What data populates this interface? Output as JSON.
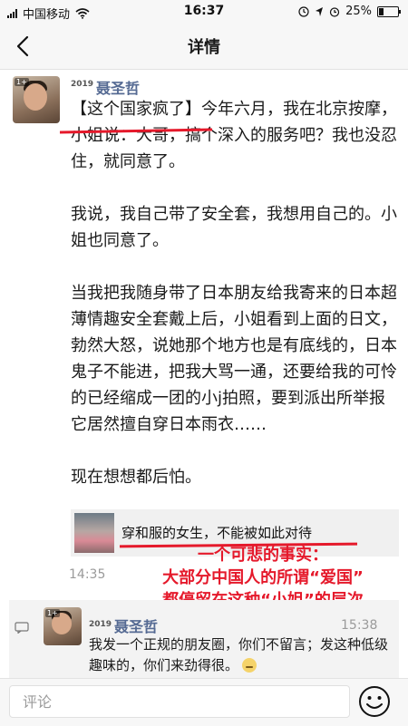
{
  "status_bar": {
    "carrier": "中国移动",
    "time": "16:37",
    "battery": "25%",
    "battery_level": 0.25
  },
  "nav": {
    "title": "详情"
  },
  "post": {
    "year_badge": "2019",
    "author": "聂圣哲",
    "avatar_tag": "1+",
    "paragraphs": [
      "【这个国家疯了】今年六月，我在北京按摩，小姐说：大哥，搞个深入的服务吧？我也没忍住，就同意了。",
      "我说，我自己带了安全套，我想用自己的。小姐也同意了。",
      "当我把我随身带了日本朋友给我寄来的日本超薄情趣安全套戴上后，小姐看到上面的日文，勃然大怒，说她那个地方也是有底线的，日本鬼子不能进，把我大骂一通，还要给我的可怜的已经缩成一团的小j拍照，要到派出所举报它居然擅自穿日本雨衣……",
      "现在想想都后怕。"
    ],
    "link_card": {
      "title": "穿和服的女生，不能被如此对待"
    },
    "time": "14:35"
  },
  "annotation": {
    "lines": [
      "一个可悲的事实：",
      "大部分中国人的所谓“爱国”",
      "都停留在这种“小姐”的层次"
    ]
  },
  "comment": {
    "year_badge": "2019",
    "author": "聂圣哲",
    "avatar_tag": "1+",
    "time": "15:38",
    "text": "我发一个正规的朋友圈，你们不留言；发这种低级趣味的，你们来劲得很。"
  },
  "bottom_bar": {
    "input_placeholder": "评论"
  },
  "colors": {
    "author_name": "#556a93",
    "annotation_red": "#e5192b",
    "timestamp_gray": "#9a9a9a"
  },
  "icons": {
    "back": "chevron-left-icon",
    "comment": "comment-bubble-icon",
    "emoji": "smiley-icon"
  }
}
